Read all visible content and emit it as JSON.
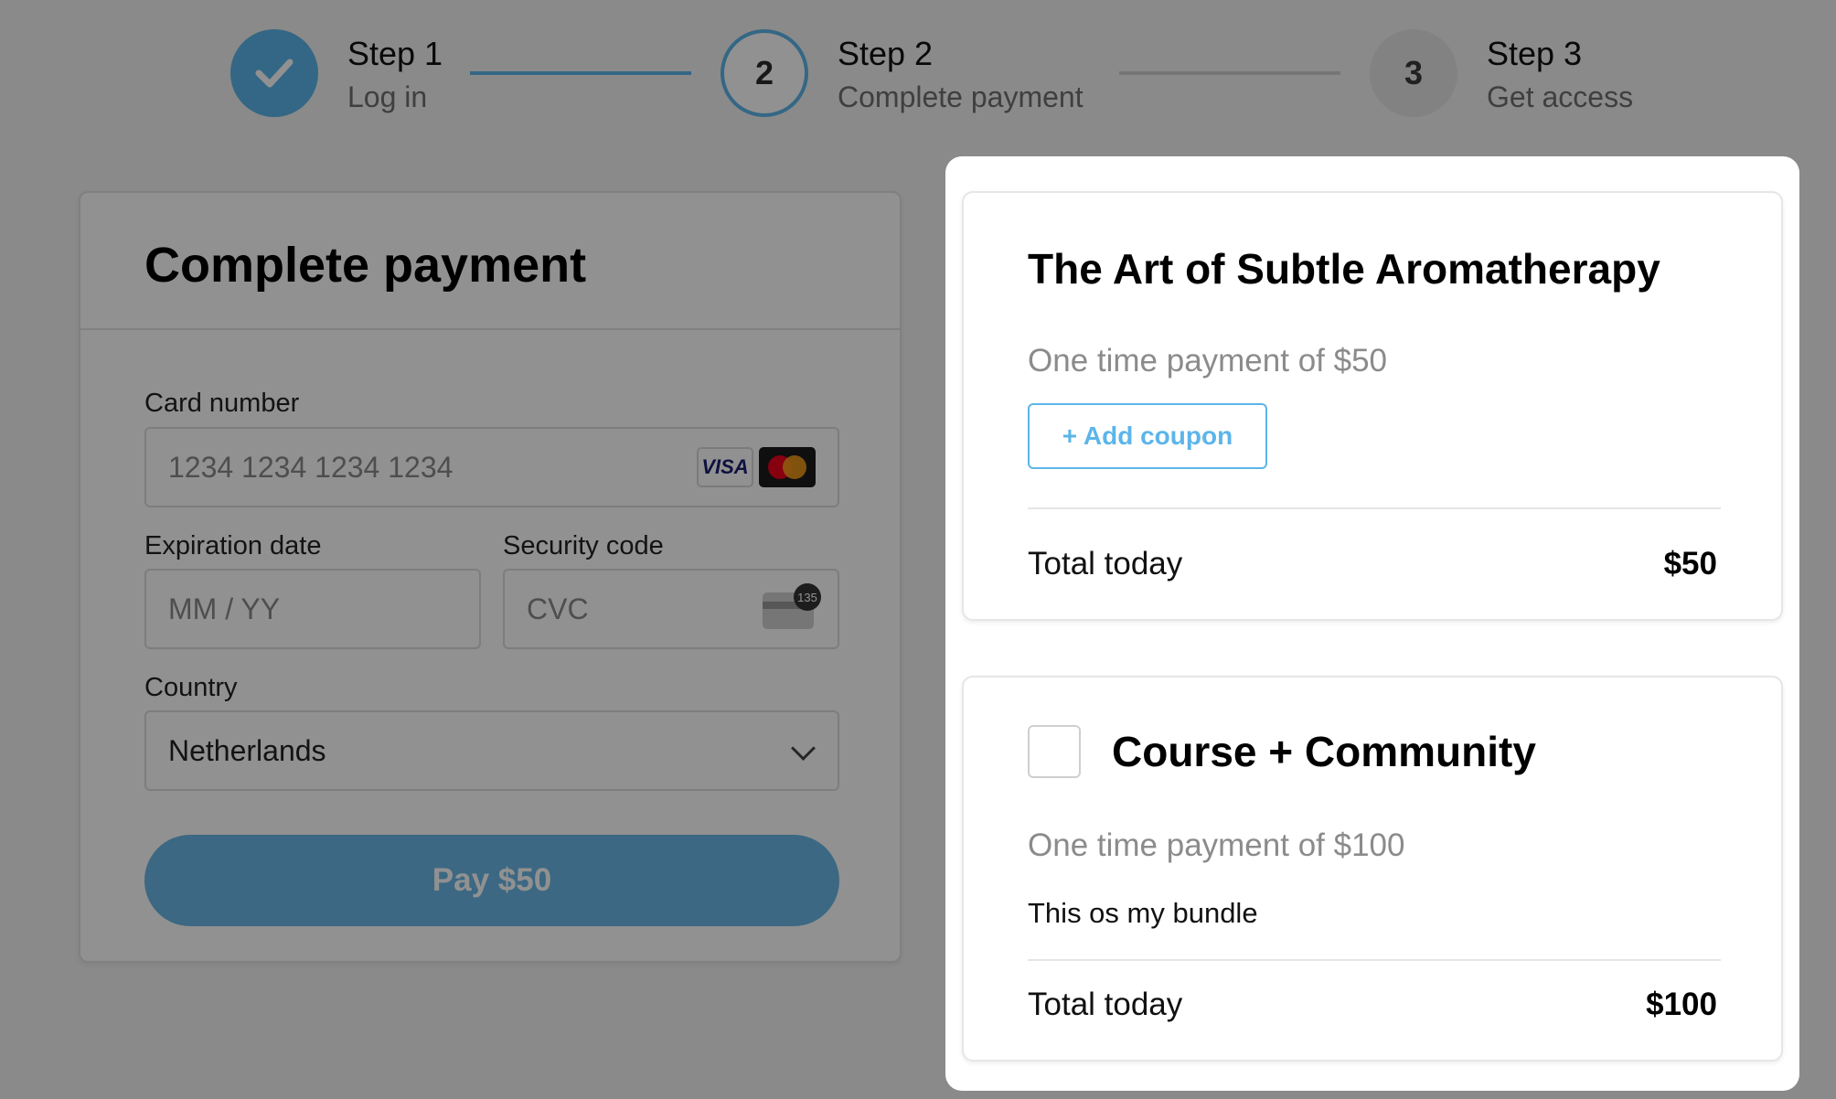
{
  "stepper": {
    "steps": [
      {
        "number": "",
        "title": "Step 1",
        "subtitle": "Log in",
        "state": "completed"
      },
      {
        "number": "2",
        "title": "Step 2",
        "subtitle": "Complete payment",
        "state": "active"
      },
      {
        "number": "3",
        "title": "Step 3",
        "subtitle": "Get access",
        "state": "pending"
      }
    ]
  },
  "payment_form": {
    "title": "Complete payment",
    "card_number": {
      "label": "Card number",
      "placeholder": "1234 1234 1234 1234",
      "brands": [
        "VISA",
        "mastercard"
      ]
    },
    "expiration": {
      "label": "Expiration date",
      "placeholder": "MM / YY"
    },
    "security_code": {
      "label": "Security code",
      "placeholder": "CVC",
      "icon_badge": "135"
    },
    "country": {
      "label": "Country",
      "value": "Netherlands"
    },
    "pay_button": "Pay $50"
  },
  "products": [
    {
      "title": "The Art of Subtle Aromatherapy",
      "subtitle": "One time payment of $50",
      "coupon_button": "+ Add coupon",
      "total_label": "Total today",
      "total_value": "$50"
    },
    {
      "title": "Course + Community",
      "subtitle": "One time payment of $100",
      "description": "This os my bundle",
      "checked": false,
      "total_label": "Total today",
      "total_value": "$100"
    }
  ],
  "colors": {
    "accent": "#5cb5ea",
    "overlay": "rgba(0,0,0,0.43)",
    "pending_step": "#e4e4e4"
  }
}
